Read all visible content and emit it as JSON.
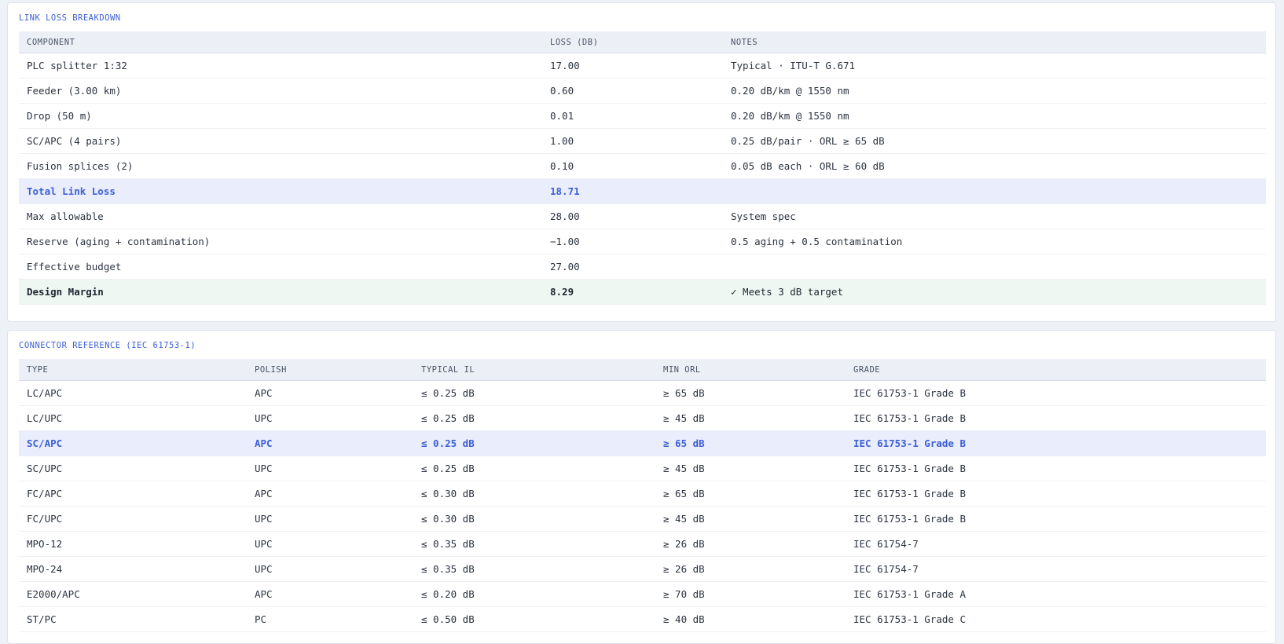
{
  "link_loss": {
    "title": "LINK LOSS BREAKDOWN",
    "columns": [
      "COMPONENT",
      "LOSS (DB)",
      "NOTES"
    ],
    "rows": [
      {
        "component": "PLC splitter 1:32",
        "loss": "17.00",
        "notes": "Typical · ITU-T G.671"
      },
      {
        "component": "Feeder (3.00 km)",
        "loss": "0.60",
        "notes": "0.20 dB/km @ 1550 nm"
      },
      {
        "component": "Drop (50 m)",
        "loss": "0.01",
        "notes": "0.20 dB/km @ 1550 nm"
      },
      {
        "component": "SC/APC (4 pairs)",
        "loss": "1.00",
        "notes": "0.25 dB/pair · ORL ≥ 65 dB"
      },
      {
        "component": "Fusion splices (2)",
        "loss": "0.10",
        "notes": "0.05 dB each · ORL ≥ 60 dB"
      },
      {
        "component": "Total Link Loss",
        "loss": "18.71",
        "notes": ""
      },
      {
        "component": "Max allowable",
        "loss": "28.00",
        "notes": "System spec"
      },
      {
        "component": "Reserve (aging + contamination)",
        "loss": "−1.00",
        "notes": "0.5 aging + 0.5 contamination"
      },
      {
        "component": "Effective budget",
        "loss": "27.00",
        "notes": ""
      },
      {
        "component": "Design Margin",
        "loss": "8.29",
        "notes": "✓ Meets 3 dB target"
      }
    ]
  },
  "connector_ref": {
    "title": "CONNECTOR REFERENCE (IEC 61753-1)",
    "columns": [
      "TYPE",
      "POLISH",
      "TYPICAL IL",
      "MIN ORL",
      "GRADE"
    ],
    "rows": [
      {
        "type": "LC/APC",
        "polish": "APC",
        "il": "≤ 0.25 dB",
        "orl": "≥ 65 dB",
        "grade": "IEC 61753-1 Grade B"
      },
      {
        "type": "LC/UPC",
        "polish": "UPC",
        "il": "≤ 0.25 dB",
        "orl": "≥ 45 dB",
        "grade": "IEC 61753-1 Grade B"
      },
      {
        "type": "SC/APC",
        "polish": "APC",
        "il": "≤ 0.25 dB",
        "orl": "≥ 65 dB",
        "grade": "IEC 61753-1 Grade B"
      },
      {
        "type": "SC/UPC",
        "polish": "UPC",
        "il": "≤ 0.25 dB",
        "orl": "≥ 45 dB",
        "grade": "IEC 61753-1 Grade B"
      },
      {
        "type": "FC/APC",
        "polish": "APC",
        "il": "≤ 0.30 dB",
        "orl": "≥ 65 dB",
        "grade": "IEC 61753-1 Grade B"
      },
      {
        "type": "FC/UPC",
        "polish": "UPC",
        "il": "≤ 0.30 dB",
        "orl": "≥ 45 dB",
        "grade": "IEC 61753-1 Grade B"
      },
      {
        "type": "MPO-12",
        "polish": "UPC",
        "il": "≤ 0.35 dB",
        "orl": "≥ 26 dB",
        "grade": "IEC 61754-7"
      },
      {
        "type": "MPO-24",
        "polish": "UPC",
        "il": "≤ 0.35 dB",
        "orl": "≥ 26 dB",
        "grade": "IEC 61754-7"
      },
      {
        "type": "E2000/APC",
        "polish": "APC",
        "il": "≤ 0.20 dB",
        "orl": "≥ 70 dB",
        "grade": "IEC 61753-1 Grade A"
      },
      {
        "type": "ST/PC",
        "polish": "PC",
        "il": "≤ 0.50 dB",
        "orl": "≥ 40 dB",
        "grade": "IEC 61753-1 Grade C"
      }
    ]
  },
  "colors": {
    "accent": "#3d5fd6",
    "header_bg": "#eceff6",
    "highlight_bg": "#e9edfc",
    "margin_bg": "#eef7f2"
  }
}
